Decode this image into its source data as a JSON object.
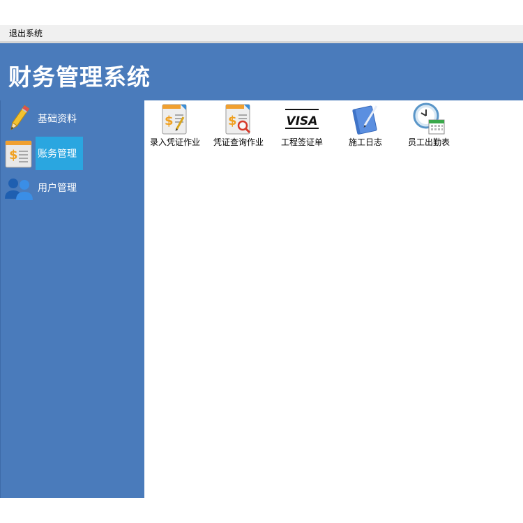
{
  "menubar": {
    "exit_label": "退出系统"
  },
  "header": {
    "title": "财务管理系统"
  },
  "sidebar": {
    "items": [
      {
        "label": "基础资料",
        "icon": "pencil-icon",
        "active": false
      },
      {
        "label": "账务管理",
        "icon": "ledger-dollar-icon",
        "active": true
      },
      {
        "label": "用户管理",
        "icon": "users-icon",
        "active": false
      }
    ]
  },
  "tools": [
    {
      "label": "录入凭证作业",
      "icon": "voucher-entry-icon"
    },
    {
      "label": "凭证查询作业",
      "icon": "voucher-search-icon"
    },
    {
      "label": "工程签证单",
      "icon": "visa-card-icon",
      "icon_text": "VISA"
    },
    {
      "label": "施工日志",
      "icon": "notebook-pen-icon"
    },
    {
      "label": "员工出勤表",
      "icon": "clock-calendar-icon"
    }
  ],
  "colors": {
    "brand_blue": "#4a7bbb",
    "active_blue": "#2aa6e0"
  }
}
